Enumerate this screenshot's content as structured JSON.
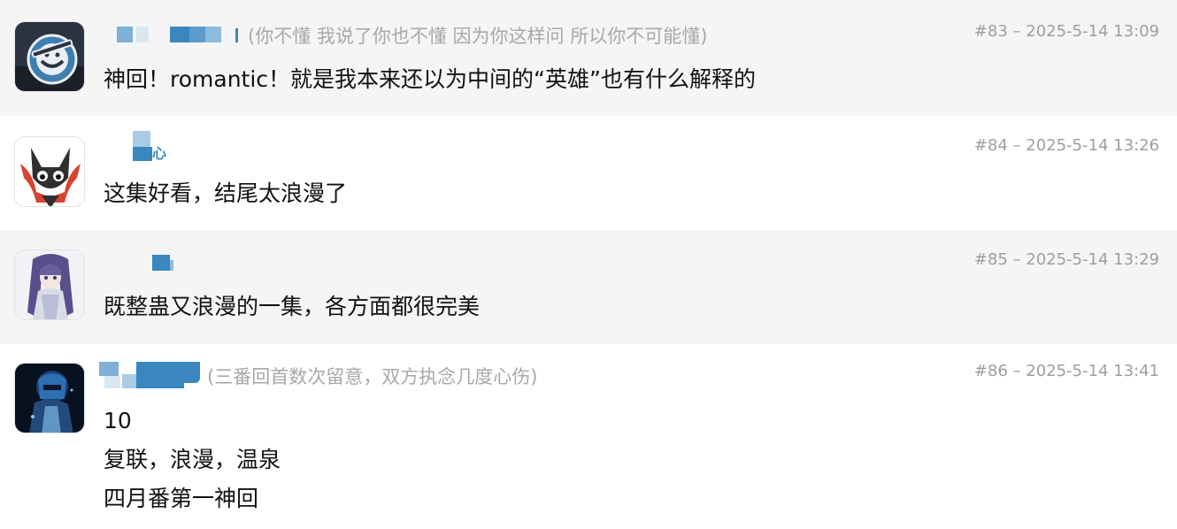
{
  "comments": [
    {
      "floor": "#83",
      "time": "2025-5-14 13:09",
      "signature": "(你不懂 我说了你也不懂 因为你这样问 所以你不可能懂)",
      "avatar": "laughing-man-logo-avatar",
      "lines": [
        "神回！romantic！就是我本来还以为中间的“英雄”也有什么解释的"
      ]
    },
    {
      "floor": "#84",
      "time": "2025-5-14 13:26",
      "signature": "",
      "avatar": "black-cat-red-scarf-avatar",
      "lines": [
        "这集好看，结尾太浪漫了"
      ]
    },
    {
      "floor": "#85",
      "time": "2025-5-14 13:29",
      "signature": "",
      "avatar": "anime-girl-purple-hair-avatar",
      "lines": [
        "既整蛊又浪漫的一集，各方面都很完美"
      ]
    },
    {
      "floor": "#86",
      "time": "2025-5-14 13:41",
      "signature": "(三番回首数次留意，双方执念几度心伤)",
      "avatar": "dark-blue-anime-avatar",
      "lines": [
        "10",
        "复联，浪漫，温泉",
        "四月番第一神回"
      ]
    }
  ],
  "ui": {
    "separator": " – ",
    "username_censor_color": "#3a87c0",
    "signature_color": "#a8a8a8",
    "meta_color": "#9e9e9e"
  }
}
